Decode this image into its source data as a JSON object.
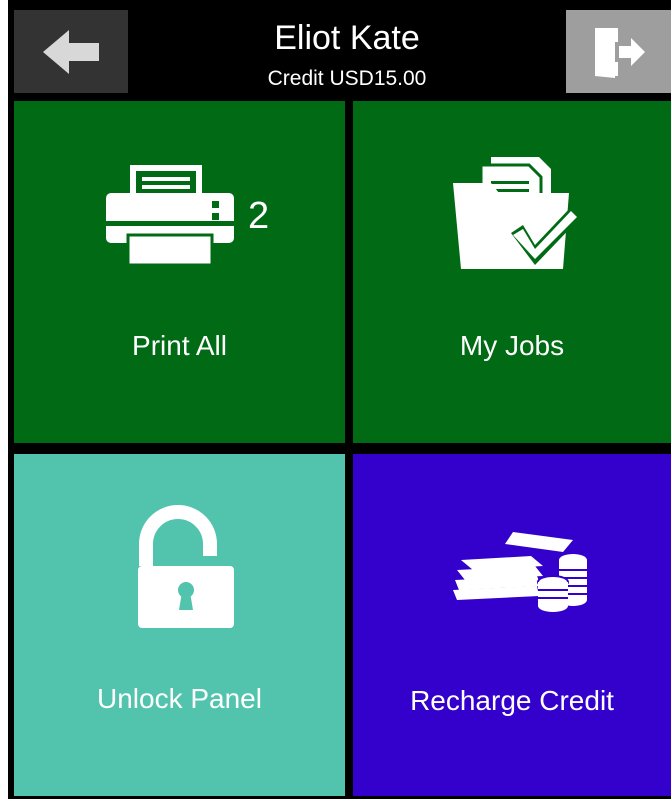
{
  "header": {
    "user_name": "Eliot Kate",
    "credit": "Credit USD15.00"
  },
  "icons": {
    "back": "arrow-left-icon",
    "logout": "logout-door-icon",
    "print": "printer-icon",
    "jobs": "folder-check-icon",
    "unlock": "padlock-open-icon",
    "recharge": "cash-coins-icon"
  },
  "tiles": {
    "print_all": {
      "label": "Print All",
      "count": "2",
      "color": "#006b14"
    },
    "my_jobs": {
      "label": "My Jobs",
      "color": "#006b14"
    },
    "unlock_panel": {
      "label": "Unlock Panel",
      "color": "#52c4ad"
    },
    "recharge_credit": {
      "label": "Recharge Credit",
      "color": "#3300cc"
    }
  }
}
